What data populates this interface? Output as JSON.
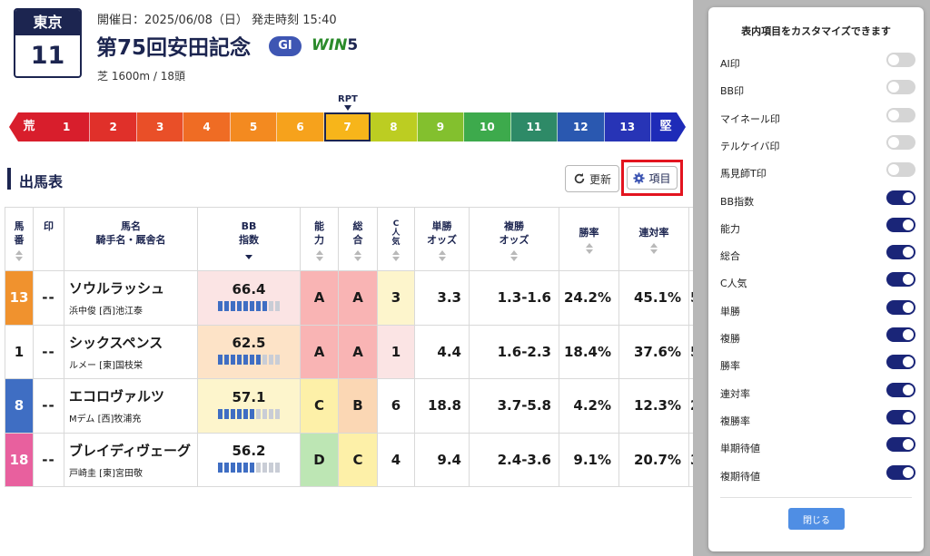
{
  "race": {
    "venue": "東京",
    "race_no": "11",
    "meta": "開催日：2025/06/08（日） 発走時刻 15:40",
    "title": "第75回安田記念",
    "grade": "GI",
    "win5_text": "WIN",
    "win5_num": "5",
    "course": "芝 1600m / 18頭"
  },
  "rpt": {
    "label": "RPT",
    "left_end": "荒",
    "right_end": "堅",
    "selected": "7",
    "cells": [
      {
        "label": "1",
        "color": "#d81e2c"
      },
      {
        "label": "2",
        "color": "#e0302a"
      },
      {
        "label": "3",
        "color": "#e94f28"
      },
      {
        "label": "4",
        "color": "#ef6c24"
      },
      {
        "label": "5",
        "color": "#f38a20"
      },
      {
        "label": "6",
        "color": "#f6a21c"
      },
      {
        "label": "7",
        "color": "#f7b51a"
      },
      {
        "label": "8",
        "color": "#bccd22"
      },
      {
        "label": "9",
        "color": "#83c02e"
      },
      {
        "label": "10",
        "color": "#3daa4c"
      },
      {
        "label": "11",
        "color": "#2e8a67"
      },
      {
        "label": "12",
        "color": "#2a58b0"
      },
      {
        "label": "13",
        "color": "#2734b6"
      }
    ]
  },
  "section": {
    "title": "出馬表",
    "refresh_label": "更新",
    "items_label": "項目"
  },
  "table": {
    "headers": {
      "umaban": [
        "馬",
        "番"
      ],
      "mark": "印",
      "horse": [
        "馬名",
        "騎手名・厩舎名"
      ],
      "bb": [
        "BB",
        "指数"
      ],
      "ability": [
        "能",
        "力"
      ],
      "total": [
        "総",
        "合"
      ],
      "cpop": [
        "C",
        "人",
        "気"
      ],
      "win_odds": [
        "単勝",
        "オッズ"
      ],
      "place_odds": [
        "複勝",
        "オッズ"
      ],
      "win_rate": "勝率",
      "quinella_rate": "連対率"
    },
    "rows": [
      {
        "umaban": "13",
        "umaban_color": "#f0922e",
        "mark": "--",
        "horse": "ソウルラッシュ",
        "jockey": "浜中俊 [西]池江泰",
        "bb": "66.4",
        "bb_level": 0.8,
        "bb_bg": "#fbe4e4",
        "ability": "A",
        "ability_bg": "#f9b4b4",
        "total": "A",
        "total_bg": "#f9b4b4",
        "cpop": "3",
        "cpop_bg": "#fdf5cc",
        "win_odds": "3.3",
        "place_odds": "1.3-1.6",
        "win_rate": "24.2%",
        "quinella_rate": "45.1%",
        "extra": "5"
      },
      {
        "umaban": "1",
        "umaban_color": "",
        "mark": "--",
        "horse": "シックスペンス",
        "jockey": "ルメー [東]国枝栄",
        "bb": "62.5",
        "bb_level": 0.7,
        "bb_bg": "#fde3c7",
        "ability": "A",
        "ability_bg": "#f9b4b4",
        "total": "A",
        "total_bg": "#f9b4b4",
        "cpop": "1",
        "cpop_bg": "#fbe4e4",
        "win_odds": "4.4",
        "place_odds": "1.6-2.3",
        "win_rate": "18.4%",
        "quinella_rate": "37.6%",
        "extra": "5"
      },
      {
        "umaban": "8",
        "umaban_color": "#3f6ec3",
        "mark": "--",
        "horse": "エコロヴァルツ",
        "jockey": "Mデム [西]牧浦充",
        "bb": "57.1",
        "bb_level": 0.6,
        "bb_bg": "#fdf5cc",
        "ability": "C",
        "ability_bg": "#fdf0a8",
        "total": "B",
        "total_bg": "#fbd7b4",
        "cpop": "6",
        "cpop_bg": "#ffffff",
        "win_odds": "18.8",
        "place_odds": "3.7-5.8",
        "win_rate": "4.2%",
        "quinella_rate": "12.3%",
        "extra": "2"
      },
      {
        "umaban": "18",
        "umaban_color": "#e8609e",
        "mark": "--",
        "horse": "ブレイディヴェーグ",
        "jockey": "戸崎圭 [東]宮田敬",
        "bb": "56.2",
        "bb_level": 0.6,
        "bb_bg": "#ffffff",
        "ability": "D",
        "ability_bg": "#bde6b4",
        "total": "C",
        "total_bg": "#fdf0a8",
        "cpop": "4",
        "cpop_bg": "#ffffff",
        "win_odds": "9.4",
        "place_odds": "2.4-3.6",
        "win_rate": "9.1%",
        "quinella_rate": "20.7%",
        "extra": "3"
      }
    ]
  },
  "modal": {
    "title": "表内項目をカスタマイズできます",
    "options": [
      {
        "label": "AI印",
        "on": false
      },
      {
        "label": "BB印",
        "on": false
      },
      {
        "label": "マイネール印",
        "on": false
      },
      {
        "label": "テルケイバ印",
        "on": false
      },
      {
        "label": "馬見師T印",
        "on": false
      },
      {
        "label": "BB指数",
        "on": true
      },
      {
        "label": "能力",
        "on": true
      },
      {
        "label": "総合",
        "on": true
      },
      {
        "label": "C人気",
        "on": true
      },
      {
        "label": "単勝",
        "on": true
      },
      {
        "label": "複勝",
        "on": true
      },
      {
        "label": "勝率",
        "on": true
      },
      {
        "label": "連対率",
        "on": true
      },
      {
        "label": "複勝率",
        "on": true
      },
      {
        "label": "単期待値",
        "on": true
      },
      {
        "label": "複期待値",
        "on": true
      }
    ],
    "close_label": "閉じる"
  }
}
